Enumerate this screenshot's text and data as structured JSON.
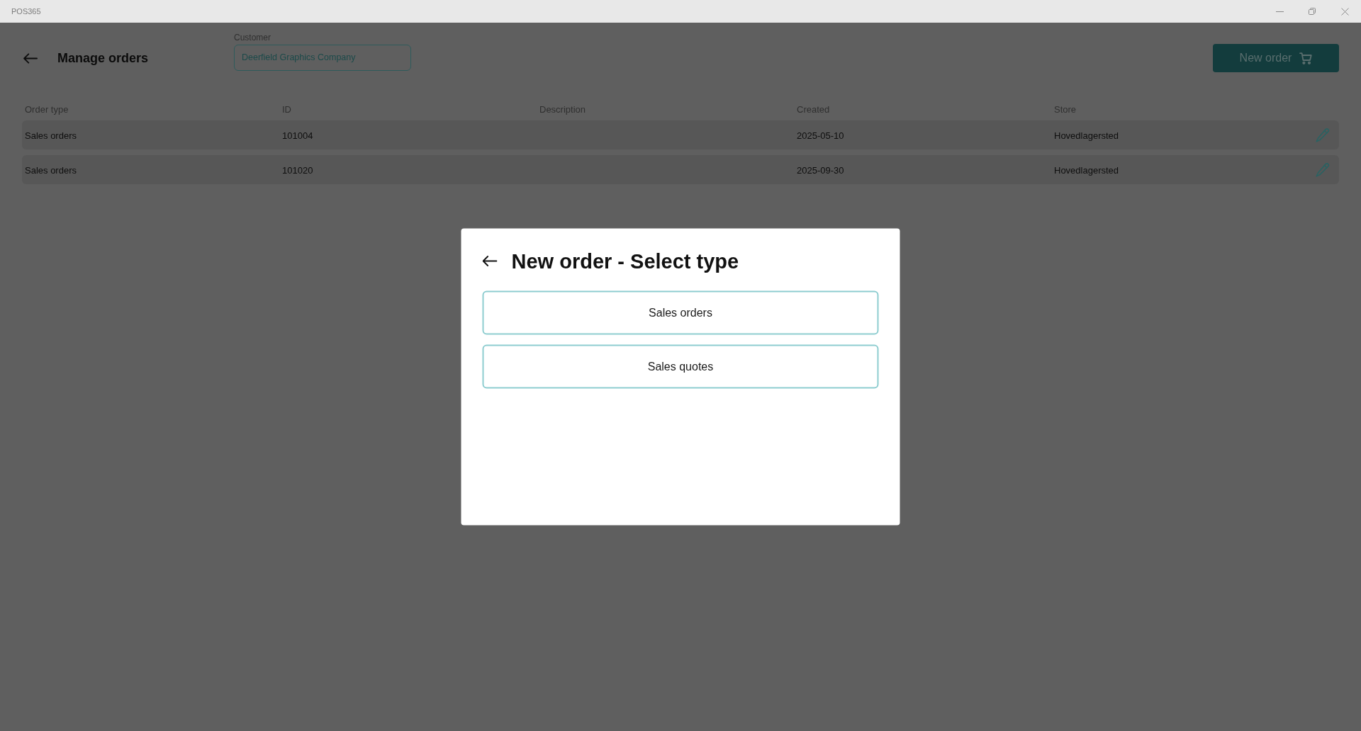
{
  "window": {
    "title": "POS365"
  },
  "header": {
    "title": "Manage orders",
    "customer": {
      "label": "Customer",
      "value": "Deerfield Graphics Company"
    },
    "new_order_button": "New order"
  },
  "table": {
    "columns": [
      "Order type",
      "ID",
      "Description",
      "Created",
      "Store"
    ],
    "rows": [
      {
        "order_type": "Sales orders",
        "id": "101004",
        "created": "2025-05-10",
        "store": "Hovedlagersted"
      },
      {
        "order_type": "Sales orders",
        "id": "101020",
        "created": "2025-09-30",
        "store": "Hovedlagersted"
      }
    ]
  },
  "dialog": {
    "title": "New order - Select type",
    "options": [
      {
        "label": "Sales orders"
      },
      {
        "label": "Sales quotes"
      }
    ]
  }
}
